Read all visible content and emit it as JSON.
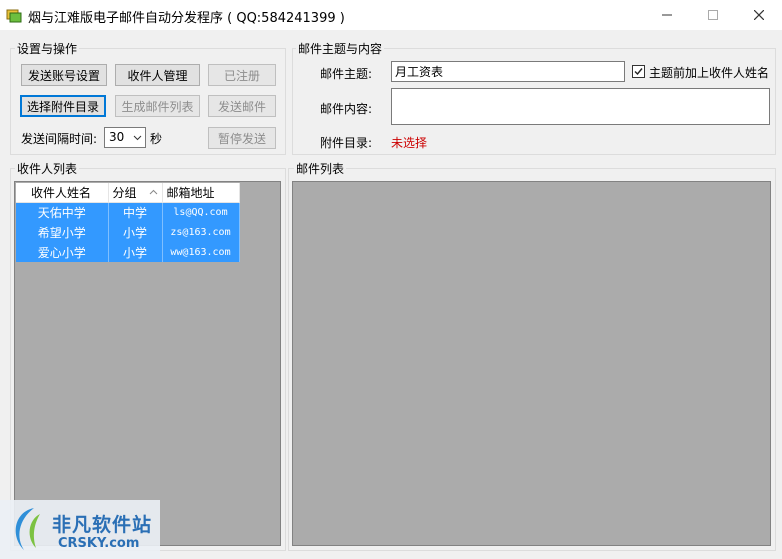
{
  "window": {
    "title": "烟与江难版电子邮件自动分发程序 ( QQ:584241399 )"
  },
  "settings": {
    "group_title": "设置与操作",
    "btn_sender": "发送账号设置",
    "btn_recipients": "收件人管理",
    "btn_registered": "已注册",
    "btn_attach_dir": "选择附件目录",
    "btn_generate": "生成邮件列表",
    "btn_send": "发送邮件",
    "interval_label": "发送间隔时间:",
    "interval_value": "30",
    "interval_unit": "秒",
    "btn_pause": "暂停发送"
  },
  "mail": {
    "group_title": "邮件主题与内容",
    "subject_label": "邮件主题:",
    "subject_value": "月工资表",
    "prefix_check_label": "主题前加上收件人姓名",
    "prefix_checked": true,
    "content_label": "邮件内容:",
    "content_value": "",
    "attach_label": "附件目录:",
    "attach_value": "未选择",
    "attach_value_color": "#cc0000"
  },
  "recipients": {
    "group_title": "收件人列表",
    "columns": [
      "收件人姓名",
      "分组",
      "邮箱地址"
    ],
    "rows": [
      [
        "天佑中学",
        "中学",
        "ls@QQ.com"
      ],
      [
        "希望小学",
        "小学",
        "zs@163.com"
      ],
      [
        "爱心小学",
        "小学",
        "ww@163.com"
      ]
    ],
    "selection_color": "#3399ff"
  },
  "mail_list": {
    "group_title": "邮件列表"
  },
  "watermark": {
    "text": "非凡软件站",
    "sub": "CRSKY.com"
  }
}
